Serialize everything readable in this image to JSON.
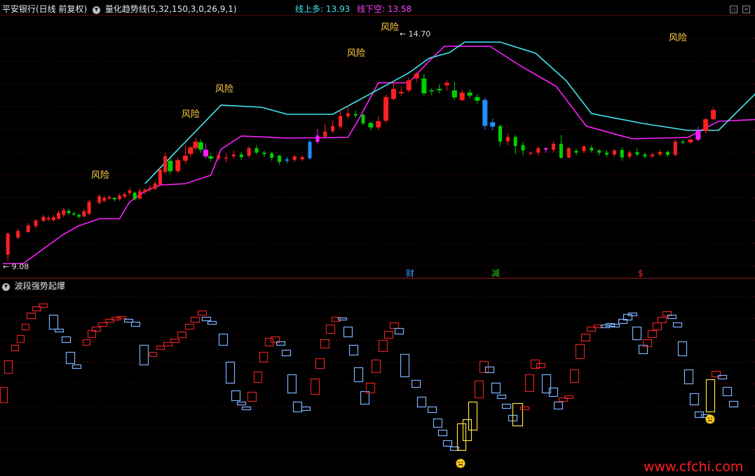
{
  "main_header": {
    "stock_title": "平安银行(日线 前复权)",
    "indicator_title": "量化趋势线(5,32,150,3,0,26,9,1)",
    "upper_line_label": "线上多:",
    "upper_line_value": "13.93",
    "lower_line_label": "线下空:",
    "lower_line_value": "13.58"
  },
  "sub_header": {
    "indicator_title": "波段强势起爆"
  },
  "markers": {
    "risk_label": "风险",
    "risk_labels": [
      "风险",
      "风险",
      "风险",
      "风险",
      "风险",
      "风险"
    ],
    "high_price": "14.70",
    "low_price": "9.08",
    "event_cai": "财",
    "event_jian": "减",
    "event_dollar": "$"
  },
  "watermark": "www.cfchi.com",
  "colors": {
    "background": "#000000",
    "grid": "#6a1010",
    "up_candle": "#ff2020",
    "down_candle": "#00d000",
    "blue_candle": "#1e90ff",
    "magenta_candle": "#ff20ff",
    "upper_line": "#40e8ee",
    "lower_line": "#ff20ff",
    "risk_text": "#ffd040",
    "upper_value_text": "#40e8ee",
    "lower_value_text": "#ff40ff",
    "sub_up_box": "#dd2020",
    "sub_down_box": "#7ab0ff",
    "sub_signal_box": "#ffe040",
    "watermark": "#ff2020"
  },
  "chart_data": [
    {
      "type": "candlestick",
      "title": "量化趋势线(5,32,150,3,0,26,9,1)",
      "annotations": [
        "风险",
        "14.70",
        "9.08",
        "财",
        "减",
        "$"
      ],
      "ylim": [
        8.85,
        15.05
      ],
      "series": [
        {
          "name": "线上多",
          "last_value": 13.93
        },
        {
          "name": "线下空",
          "last_value": 13.58
        }
      ],
      "x": [
        2,
        6,
        10,
        13,
        16,
        18,
        20,
        22,
        24,
        26,
        28,
        30,
        32,
        34,
        38,
        40,
        42,
        44,
        46,
        48,
        50,
        52,
        54,
        56,
        58,
        60,
        62,
        64,
        66,
        69,
        72,
        74,
        76,
        78,
        80,
        82,
        85,
        88,
        91,
        94,
        97,
        100,
        103,
        106,
        109,
        112,
        115,
        118,
        121,
        124,
        127,
        130,
        133,
        136,
        139,
        142,
        145,
        148,
        151,
        154,
        157,
        160,
        163,
        166,
        169,
        172,
        175,
        178,
        181,
        184,
        187,
        190,
        193,
        196,
        199,
        202,
        205,
        208,
        211,
        214,
        217,
        220,
        223,
        226,
        229,
        232,
        235,
        238,
        241,
        244,
        247,
        250,
        253,
        256,
        259,
        262,
        265,
        268,
        271,
        274,
        277,
        280
      ],
      "ohlc": [
        [
          9.25,
          9.82,
          9.08,
          9.85
        ],
        [
          9.71,
          9.89,
          9.67,
          9.96
        ],
        [
          9.86,
          10.04,
          9.84,
          10.1
        ],
        [
          10.02,
          10.17,
          9.95,
          10.22
        ],
        [
          10.16,
          10.27,
          10.12,
          10.33
        ],
        [
          10.2,
          10.24,
          10.15,
          10.3
        ],
        [
          10.18,
          10.26,
          10.13,
          10.32
        ],
        [
          10.22,
          10.38,
          10.19,
          10.44
        ],
        [
          10.32,
          10.45,
          10.26,
          10.5
        ],
        [
          10.43,
          10.37,
          10.31,
          10.49
        ],
        [
          10.36,
          10.33,
          10.3,
          10.4
        ],
        [
          10.32,
          10.27,
          10.22,
          10.36
        ],
        [
          10.28,
          10.42,
          10.25,
          10.48
        ],
        [
          10.35,
          10.68,
          10.31,
          10.73
        ],
        [
          10.65,
          10.82,
          10.6,
          10.88
        ],
        [
          10.7,
          10.78,
          10.66,
          10.84
        ],
        [
          10.76,
          10.8,
          10.74,
          10.86
        ],
        [
          10.78,
          10.74,
          10.68,
          10.8
        ],
        [
          10.75,
          10.84,
          10.7,
          10.9
        ],
        [
          10.82,
          10.88,
          10.76,
          10.95
        ],
        [
          10.91,
          10.98,
          10.84,
          11.06
        ],
        [
          10.92,
          10.75,
          10.71,
          10.96
        ],
        [
          10.76,
          10.96,
          10.74,
          11.03
        ],
        [
          10.94,
          11.0,
          10.88,
          11.05
        ],
        [
          11.0,
          11.05,
          10.94,
          11.13
        ],
        [
          11.03,
          11.17,
          10.98,
          11.22
        ],
        [
          11.14,
          11.54,
          11.1,
          11.58
        ],
        [
          11.48,
          11.9,
          11.43,
          12.0
        ],
        [
          11.78,
          11.5,
          11.42,
          11.85
        ],
        [
          11.5,
          11.8,
          11.45,
          11.87
        ],
        [
          11.78,
          11.92,
          11.7,
          12.21
        ],
        [
          11.96,
          12.14,
          11.88,
          12.19
        ],
        [
          12.12,
          12.3,
          12.06,
          12.4
        ],
        [
          12.28,
          12.08,
          12.0,
          12.36
        ],
        [
          12.08,
          11.9,
          11.83,
          12.25
        ],
        [
          11.9,
          11.84,
          11.76,
          12.0
        ],
        [
          11.84,
          11.93,
          11.78,
          11.98
        ],
        [
          11.86,
          11.87,
          11.74,
          11.99
        ],
        [
          11.9,
          11.95,
          11.84,
          12.06
        ],
        [
          11.95,
          11.88,
          11.8,
          12.02
        ],
        [
          11.92,
          12.12,
          11.86,
          12.18
        ],
        [
          12.12,
          12.0,
          11.95,
          12.2
        ],
        [
          12.0,
          11.96,
          11.88,
          12.06
        ],
        [
          11.98,
          11.86,
          11.78,
          12.02
        ],
        [
          11.92,
          11.75,
          11.68,
          11.94
        ],
        [
          11.78,
          11.82,
          11.72,
          11.88
        ],
        [
          11.8,
          11.9,
          11.74,
          11.94
        ],
        [
          11.82,
          11.88,
          11.76,
          11.92
        ],
        [
          11.85,
          12.29,
          11.82,
          12.34
        ],
        [
          12.29,
          12.46,
          12.24,
          12.63
        ],
        [
          12.43,
          12.57,
          12.38,
          12.77
        ],
        [
          12.58,
          12.72,
          12.52,
          12.86
        ],
        [
          12.7,
          12.99,
          12.64,
          13.15
        ],
        [
          12.98,
          13.06,
          12.92,
          13.28
        ],
        [
          13.04,
          13.0,
          12.94,
          13.14
        ],
        [
          13.02,
          12.79,
          12.74,
          13.05
        ],
        [
          12.8,
          12.68,
          12.6,
          12.84
        ],
        [
          12.68,
          12.85,
          12.62,
          12.98
        ],
        [
          12.86,
          13.5,
          12.8,
          13.56
        ],
        [
          13.45,
          13.72,
          13.4,
          13.95
        ],
        [
          13.6,
          13.64,
          13.52,
          13.79
        ],
        [
          13.68,
          13.95,
          13.62,
          14.02
        ],
        [
          14.0,
          14.13,
          13.9,
          14.18
        ],
        [
          14.0,
          13.6,
          13.52,
          14.13
        ],
        [
          13.68,
          13.67,
          13.55,
          13.74
        ],
        [
          13.72,
          13.68,
          13.6,
          13.84
        ],
        [
          13.82,
          13.88,
          13.68,
          13.95
        ],
        [
          13.68,
          13.49,
          13.42,
          13.9
        ],
        [
          13.42,
          13.62,
          13.38,
          13.7
        ],
        [
          13.62,
          13.54,
          13.46,
          13.7
        ],
        [
          13.5,
          13.4,
          13.32,
          13.58
        ],
        [
          13.42,
          12.72,
          12.62,
          13.49
        ],
        [
          12.82,
          12.7,
          12.6,
          12.92
        ],
        [
          12.72,
          12.3,
          12.18,
          12.76
        ],
        [
          12.3,
          12.42,
          12.2,
          12.52
        ],
        [
          12.42,
          12.18,
          11.96,
          12.48
        ],
        [
          12.2,
          12.06,
          11.92,
          12.3
        ],
        [
          11.99,
          12.0,
          11.92,
          12.04
        ],
        [
          12.0,
          12.12,
          11.92,
          12.18
        ],
        [
          12.12,
          12.08,
          12.0,
          12.14
        ],
        [
          12.08,
          12.24,
          12.0,
          12.3
        ],
        [
          12.24,
          11.86,
          11.84,
          12.47
        ],
        [
          11.87,
          12.12,
          11.84,
          12.16
        ],
        [
          12.05,
          12.0,
          11.93,
          12.1
        ],
        [
          12.04,
          12.17,
          11.98,
          12.2
        ],
        [
          12.13,
          12.06,
          12.0,
          12.2
        ],
        [
          12.06,
          12.0,
          11.92,
          12.1
        ],
        [
          12.0,
          11.95,
          11.88,
          12.07
        ],
        [
          11.95,
          12.06,
          11.88,
          12.1
        ],
        [
          12.07,
          11.87,
          11.78,
          12.14
        ],
        [
          11.89,
          12.0,
          11.82,
          12.06
        ],
        [
          12.01,
          11.95,
          11.9,
          12.12
        ],
        [
          11.95,
          11.9,
          11.84,
          12.0
        ],
        [
          11.9,
          11.95,
          11.86,
          12.0
        ],
        [
          11.95,
          12.02,
          11.9,
          12.08
        ],
        [
          12.02,
          11.94,
          11.88,
          12.06
        ],
        [
          11.94,
          12.3,
          11.9,
          12.36
        ],
        [
          12.3,
          12.28,
          12.22,
          12.36
        ],
        [
          12.28,
          12.35,
          12.24,
          12.4
        ],
        [
          12.35,
          12.6,
          12.3,
          12.7
        ],
        [
          12.58,
          12.9,
          12.52,
          12.94
        ],
        [
          12.9,
          13.15,
          12.86,
          13.22
        ]
      ]
    },
    {
      "type": "box-sequence",
      "title": "波段强势起爆",
      "signal_annotation": "☹"
    }
  ]
}
